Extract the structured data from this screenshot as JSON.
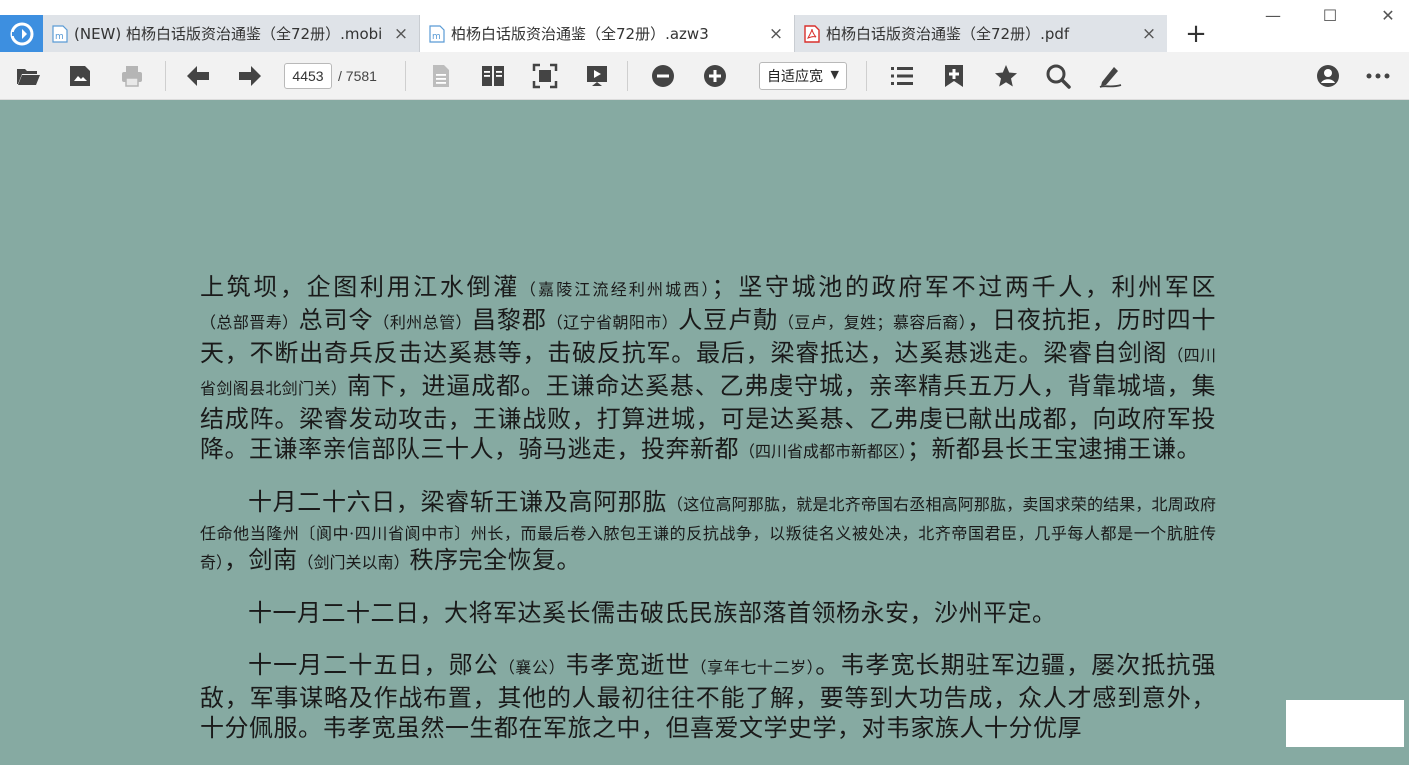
{
  "tabs": [
    {
      "label": "(NEW) 柏杨白话版资治通鉴（全72册）.mobi",
      "icon": "mobi-file-icon",
      "close": "×"
    },
    {
      "label": "柏杨白话版资治通鉴（全72册）.azw3",
      "icon": "azw3-file-icon",
      "close": "×"
    },
    {
      "label": "柏杨白话版资治通鉴（全72册）.pdf",
      "icon": "pdf-file-icon",
      "close": "×"
    }
  ],
  "new_tab": "+",
  "window": {
    "minimize": "—",
    "maximize": "☐",
    "close": "✕"
  },
  "toolbar": {
    "page_current": "4453",
    "page_total": "/ 7581",
    "zoom_mode": "自适应宽",
    "zoom_arrow": "▼"
  },
  "document": {
    "paragraphs": [
      [
        {
          "t": "上筑坝，企图利用江水倒灌"
        },
        {
          "n": "（嘉陵江流经利州城西）"
        },
        {
          "t": "；坚守城池的政府军不过两千人，利州军区"
        },
        {
          "n": "（总部晋寿）"
        },
        {
          "t": "总司令"
        },
        {
          "n": "（利州总管）"
        },
        {
          "t": "昌黎郡"
        },
        {
          "n": "（辽宁省朝阳市）"
        },
        {
          "t": "人豆卢勣"
        },
        {
          "n": "（豆卢，复姓；慕容后裔）"
        },
        {
          "t": "，日夜抗拒，历时四十天，不断出奇兵反击达奚惎等，击破反抗军。最后，梁睿抵达，达奚惎逃走。梁睿自剑阁"
        },
        {
          "n": "（四川省剑阁县北剑门关）"
        },
        {
          "t": "南下，进逼成都。王谦命达奚惎、乙弗虔守城，亲率精兵五万人，背靠城墙，集结成阵。梁睿发动攻击，王谦战败，打算进城，可是达奚惎、乙弗虔已献出成都，向政府军投降。王谦率亲信部队三十人，骑马逃走，投奔新都"
        },
        {
          "n": "（四川省成都市新都区）"
        },
        {
          "t": "；新都县长王宝逮捕王谦。"
        }
      ],
      [
        {
          "t": "十月二十六日，梁睿斩王谦及高阿那肱"
        },
        {
          "n": "（这位高阿那肱，就是北齐帝国右丞相高阿那肱，卖国求荣的结果，北周政府任命他当隆州〔阆中·四川省阆中市〕州长，而最后卷入脓包王谦的反抗战争，以叛徒名义被处决，北齐帝国君臣，几乎每人都是一个肮脏传奇）"
        },
        {
          "t": "，剑南"
        },
        {
          "n": "（剑门关以南）"
        },
        {
          "t": "秩序完全恢复。"
        }
      ],
      [
        {
          "t": "十一月二十二日，大将军达奚长儒击破氐民族部落首领杨永安，沙州平定。"
        }
      ],
      [
        {
          "t": "十一月二十五日，郧公"
        },
        {
          "n": "（襄公）"
        },
        {
          "t": "韦孝宽逝世"
        },
        {
          "n": "（享年七十二岁）"
        },
        {
          "t": "。韦孝宽长期驻军边疆，屡次抵抗强敌，军事谋略及作战布置，其他的人最初往往不能了解，要等到大功告成，众人才感到意外，十分佩服。韦孝宽虽然一生都在军旅之中，但喜爱文学史学，对韦家族人十分优厚"
        }
      ]
    ]
  },
  "colors": {
    "page_bg": "#86aaa2",
    "tab_active": "#ffffff",
    "tab_inactive": "#dfe3e8",
    "app_icon": "#3d8fe0"
  }
}
